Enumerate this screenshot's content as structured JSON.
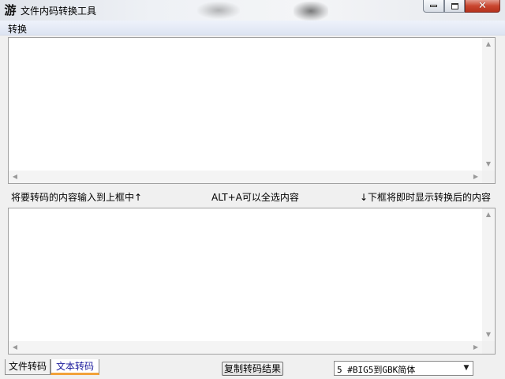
{
  "window": {
    "title": "文件内码转换工具",
    "app_icon_glyph": "游"
  },
  "menu": {
    "items": [
      "转换"
    ]
  },
  "hints": {
    "left": "将要转码的内容输入到上框中↑",
    "middle": "ALT+A可以全选内容",
    "right": "↓下框将即时显示转换后的内容"
  },
  "input_box": {
    "value": ""
  },
  "output_box": {
    "value": ""
  },
  "tabs": [
    {
      "label": "文件转码",
      "selected": false
    },
    {
      "label": "文本转码",
      "selected": true
    }
  ],
  "copy_button": {
    "label": "复制转码结果"
  },
  "conversion_select": {
    "selected": "5 #BIG5到GBK简体"
  },
  "icons": {
    "minimize": "minimize-icon",
    "maximize": "maximize-icon",
    "close": "close-icon",
    "scroll_up": "▲",
    "scroll_down": "▼",
    "scroll_left": "◀",
    "scroll_right": "▶",
    "dropdown": "▼"
  },
  "colors": {
    "active_tab_text": "#1a1a9c",
    "active_tab_underline": "#f2a23a",
    "close_button": "#c9462f"
  }
}
